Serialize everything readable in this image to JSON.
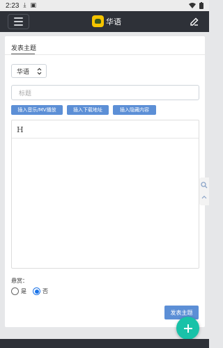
{
  "status": {
    "time": "2:23"
  },
  "header": {
    "brand": "华语"
  },
  "card": {
    "tab": "发表主题",
    "language_select": "华语",
    "title_placeholder": "标题",
    "buttons": [
      "插入音乐/MV播放",
      "插入下载地址",
      "插入隐藏内容"
    ],
    "editor_heading_tool": "H",
    "reward_label": "悬赏：",
    "reward_options": [
      "是",
      "否"
    ],
    "reward_selected": "否",
    "submit": "发表主题"
  },
  "colors": {
    "navbar": "#2e3138",
    "accent_button": "#5c8fd6",
    "fab": "#19c2a8",
    "brand_logo": "#f5c400"
  },
  "icons": {
    "menu": "hamburger-icon",
    "edit": "edit-icon",
    "fab": "plus-icon",
    "search": "search-icon"
  }
}
